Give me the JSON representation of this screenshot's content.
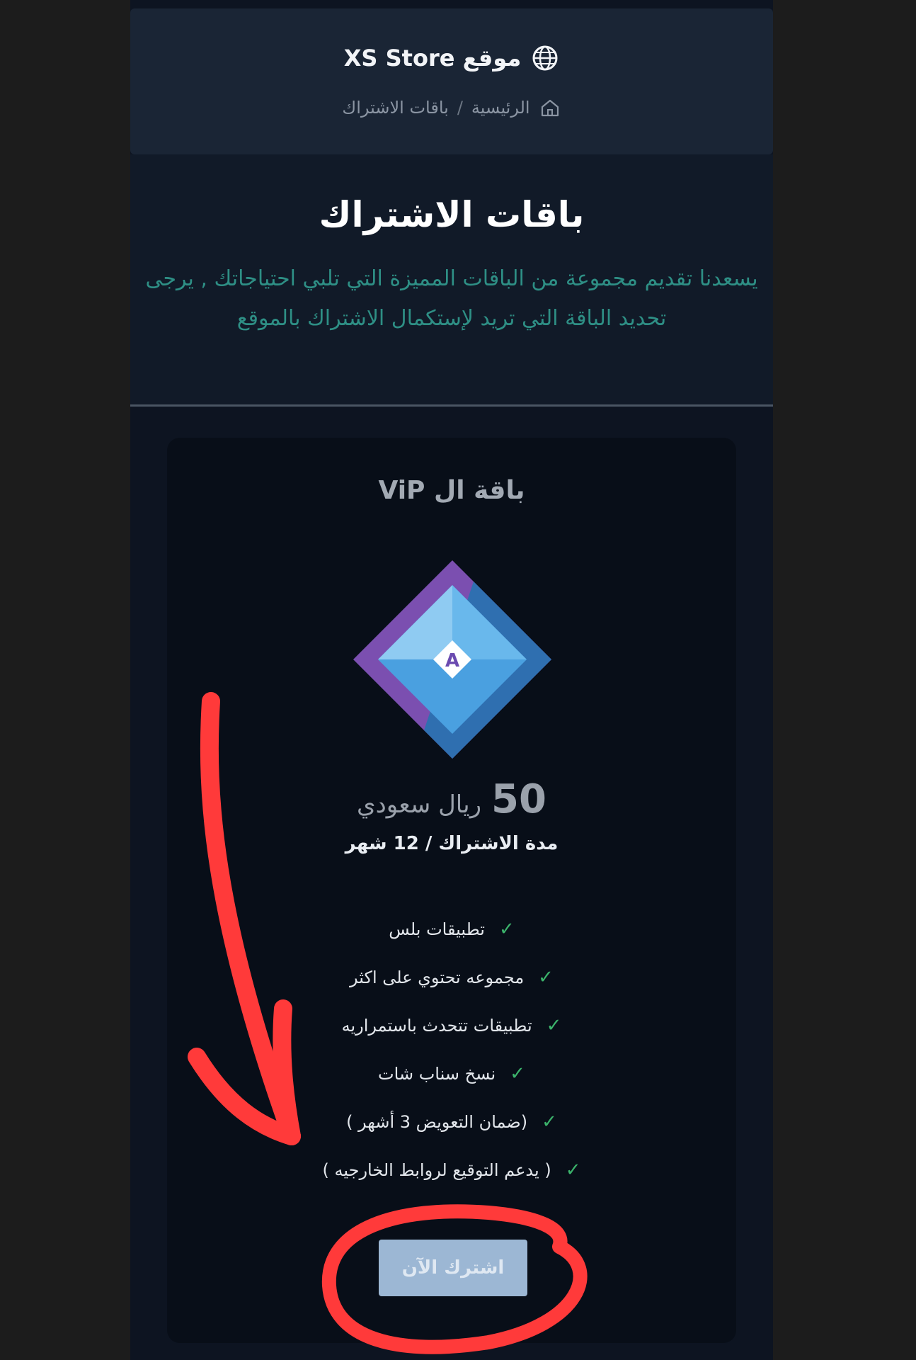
{
  "header": {
    "site_title": "موقع XS Store",
    "breadcrumb": {
      "home": "الرئيسية",
      "separator": "/",
      "current": "باقات الاشتراك"
    }
  },
  "hero": {
    "title": "باقات الاشتراك",
    "description": "يسعدنا تقديم مجموعة من الباقات المميزة التي تلبي احتياجاتك , يرجى تحديد الباقة التي تريد لإستكمال الاشتراك بالموقع"
  },
  "plan": {
    "title": "باقة ال ViP",
    "price_amount": "50",
    "price_currency": "ريال سعودي",
    "duration": "مدة الاشتراك / 12 شهر",
    "features": [
      "تطبيقات بلس",
      "مجموعه تحتوي على اكثر",
      "تطبيقات تتحدث باستمراريه",
      "نسخ سناب شات",
      "(ضمان التعويض 3 أشهر )",
      "( يدعم التوقيع لروابط الخارجيه )"
    ],
    "check_mark": "✓",
    "button_label": "اشترك الآن"
  },
  "icons": {
    "globe": "globe-icon",
    "home": "home-icon",
    "badge": "app-store-diamond-icon",
    "check": "check-icon"
  },
  "colors": {
    "page_bg": "#0d1421",
    "accent_teal": "#2e8f85",
    "check_green": "#3bb36b",
    "button_bg": "#9cb7d4",
    "annotation_red": "#ff3a3a"
  }
}
